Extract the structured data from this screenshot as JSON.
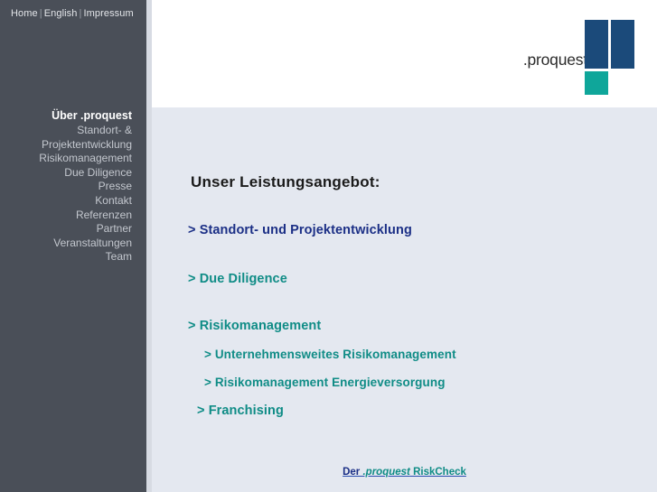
{
  "topnav": {
    "items": [
      {
        "label": "Home",
        "name": "topnav-home"
      },
      {
        "label": "English",
        "name": "topnav-english"
      },
      {
        "label": "Impressum",
        "name": "topnav-impressum"
      }
    ],
    "separator": "|"
  },
  "sidebar": {
    "items": [
      {
        "label": "Über .proquest",
        "active": true
      },
      {
        "label": "Standort- &\nProjektentwicklung",
        "active": false
      },
      {
        "label": "Risikomanagement",
        "active": false
      },
      {
        "label": "Due Diligence",
        "active": false
      },
      {
        "label": "Presse",
        "active": false
      },
      {
        "label": "Kontakt",
        "active": false
      },
      {
        "label": "Referenzen",
        "active": false
      },
      {
        "label": "Partner",
        "active": false
      },
      {
        "label": "Veranstaltungen",
        "active": false
      },
      {
        "label": "Team",
        "active": false
      }
    ]
  },
  "logo": {
    "wordmark": ".proquest",
    "block_color_primary": "#1b4a7a",
    "block_color_accent": "#0fa69a"
  },
  "main": {
    "title": "Unser Leistungsangebot:",
    "services": [
      {
        "label": "> Standort- und Projektentwicklung",
        "color": "#1b2f86",
        "level": 1
      },
      {
        "label": "> Due Diligence",
        "color": "#0f8c86",
        "level": 1
      },
      {
        "label": "> Risikomanagement",
        "color": "#0f8c86",
        "level": 1
      },
      {
        "label": "> Unternehmensweites Risikomanagement",
        "color": "#0f8c86",
        "level": 2
      },
      {
        "label": "> Risikomanagement Energieversorgung",
        "color": "#0f8c86",
        "level": 2
      },
      {
        "label": "> Franchising",
        "color": "#0f8c86",
        "level": 1
      }
    ]
  },
  "footer": {
    "link_prefix": "Der ",
    "link_brand": ".proquest",
    "link_suffix": " RiskCheck "
  },
  "colors": {
    "sidebar_bg": "#4a4f58",
    "content_bg": "#e4e8f0",
    "header_bg": "#ffffff",
    "accent_teal": "#0f8c86",
    "accent_navy": "#1b2f86"
  }
}
